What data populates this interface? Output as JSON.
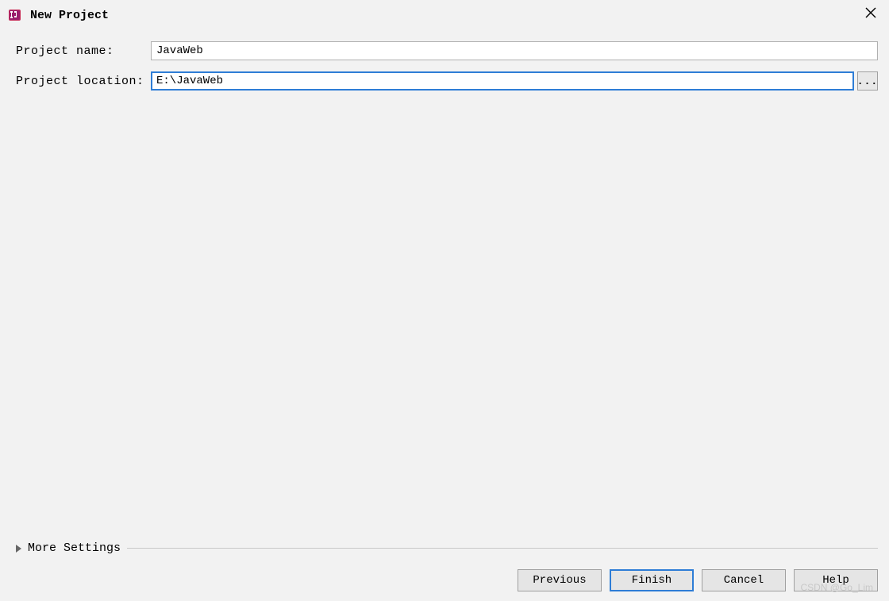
{
  "window": {
    "title": "New Project"
  },
  "form": {
    "project_name_label": "Project name:",
    "project_name_value": "JavaWeb",
    "project_location_label": "Project location:",
    "project_location_value": "E:\\JavaWeb",
    "browse_label": "..."
  },
  "more_settings": {
    "label": "More Settings"
  },
  "buttons": {
    "previous": "Previous",
    "finish": "Finish",
    "cancel": "Cancel",
    "help": "Help"
  },
  "watermark": "CSDN @Go_Lim"
}
